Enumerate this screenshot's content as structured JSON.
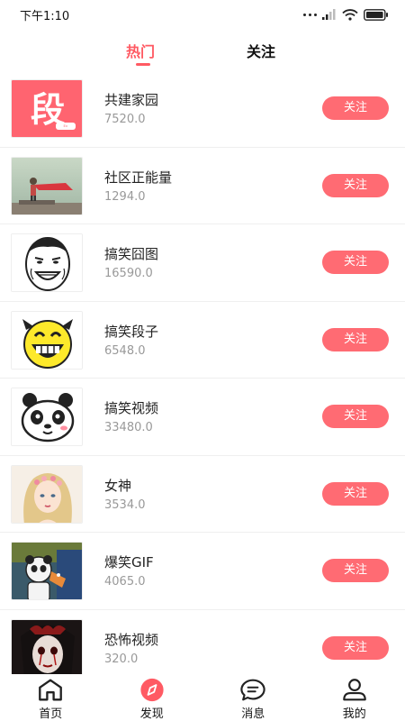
{
  "status": {
    "time": "下午1:10"
  },
  "tabs": {
    "hot": "热门",
    "follow": "关注"
  },
  "items": [
    {
      "title": "共建家园",
      "count": "7520.0",
      "button": "关注",
      "icon": "duan-logo-icon"
    },
    {
      "title": "社区正能量",
      "count": "1294.0",
      "button": "关注",
      "icon": "cape-kid-photo-icon"
    },
    {
      "title": "搞笑囧图",
      "count": "16590.0",
      "button": "关注",
      "icon": "meme-face-icon"
    },
    {
      "title": "搞笑段子",
      "count": "6548.0",
      "button": "关注",
      "icon": "laughing-smiley-icon"
    },
    {
      "title": "搞笑视频",
      "count": "33480.0",
      "button": "关注",
      "icon": "panda-icon"
    },
    {
      "title": "女神",
      "count": "3534.0",
      "button": "关注",
      "icon": "girl-portrait-icon"
    },
    {
      "title": "爆笑GIF",
      "count": "4065.0",
      "button": "关注",
      "icon": "cartoon-panda-icon"
    },
    {
      "title": "恐怖视频",
      "count": "320.0",
      "button": "关注",
      "icon": "horror-doll-icon"
    }
  ],
  "tabbar": [
    {
      "label": "首页",
      "icon": "home-icon"
    },
    {
      "label": "发现",
      "icon": "discover-compass-icon"
    },
    {
      "label": "消息",
      "icon": "message-bubble-icon"
    },
    {
      "label": "我的",
      "icon": "person-icon"
    }
  ],
  "colors": {
    "accent": "#ff5a63",
    "button": "#ff6b73",
    "count": "#999999"
  }
}
